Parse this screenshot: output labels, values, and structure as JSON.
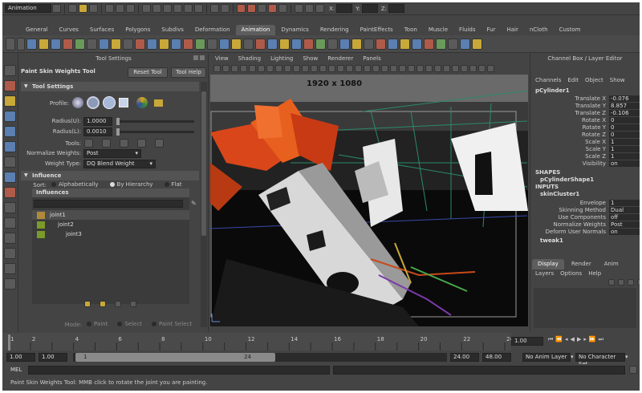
{
  "status_line": {
    "mode": "Animation",
    "x_label": "X:",
    "y_label": "Y:",
    "z_label": "Z:"
  },
  "shelf_tabs": [
    "General",
    "Curves",
    "Surfaces",
    "Polygons",
    "Subdivs",
    "Deformation",
    "Animation",
    "Dynamics",
    "Rendering",
    "PaintEffects",
    "Toon",
    "Muscle",
    "Fluids",
    "Fur",
    "Hair",
    "nCloth",
    "Custom"
  ],
  "shelf_active": "Animation",
  "tool_settings": {
    "panel_title": "Tool Settings",
    "tool_name": "Paint Skin Weights Tool",
    "reset_tool": "Reset Tool",
    "tool_help": "Tool Help",
    "section_title": "Tool Settings",
    "profile_label": "Profile:",
    "radius_u_label": "Radius(U):",
    "radius_u_value": "1.0000",
    "radius_l_label": "Radius(L):",
    "radius_l_value": "0.0010",
    "tools_label": "Tools:",
    "normalize_label": "Normalize Weights:",
    "normalize_value": "Post",
    "weight_type_label": "Weight Type:",
    "weight_type_value": "DQ Blend Weight",
    "influence_title": "Influence",
    "sort_label": "Sort:",
    "sort_options": [
      "Alphabetically",
      "By Hierarchy",
      "Flat"
    ],
    "sort_selected": "By Hierarchy",
    "influences_header": "Influences",
    "joints": [
      "joint1",
      "joint2",
      "joint3"
    ],
    "mode_label": "Mode:",
    "mode_options": [
      "Paint",
      "Select",
      "Paint Select"
    ]
  },
  "viewport": {
    "menu": [
      "View",
      "Shading",
      "Lighting",
      "Show",
      "Renderer",
      "Panels"
    ],
    "resolution": "1920 x 1080"
  },
  "channel_box": {
    "title": "Channel Box / Layer Editor",
    "menu": [
      "Channels",
      "Edit",
      "Object",
      "Show"
    ],
    "object": "pCylinder1",
    "channels": [
      {
        "name": "Translate X",
        "value": "-0.076"
      },
      {
        "name": "Translate Y",
        "value": "8.857"
      },
      {
        "name": "Translate Z",
        "value": "-0.106"
      },
      {
        "name": "Rotate X",
        "value": "0"
      },
      {
        "name": "Rotate Y",
        "value": "0"
      },
      {
        "name": "Rotate Z",
        "value": "0"
      },
      {
        "name": "Scale X",
        "value": "1"
      },
      {
        "name": "Scale Y",
        "value": "1"
      },
      {
        "name": "Scale Z",
        "value": "1"
      },
      {
        "name": "Visibility",
        "value": "on"
      }
    ],
    "shapes_label": "SHAPES",
    "shape_name": "pCylinderShape1",
    "inputs_label": "INPUTS",
    "input_name": "skinCluster1",
    "input_channels": [
      {
        "name": "Envelope",
        "value": "1"
      },
      {
        "name": "Skinning Method",
        "value": "Dual Qua..."
      },
      {
        "name": "Use Components",
        "value": "off"
      },
      {
        "name": "Normalize Weights",
        "value": "Post"
      },
      {
        "name": "Deform User Normals",
        "value": "on"
      }
    ],
    "tweak": "tweak1",
    "layer_tabs": [
      "Display",
      "Render",
      "Anim"
    ],
    "layer_menu": [
      "Layers",
      "Options",
      "Help"
    ]
  },
  "timeline": {
    "ticks": [
      "1",
      "2",
      "4",
      "6",
      "8",
      "10",
      "12",
      "14",
      "16",
      "18",
      "20",
      "22",
      "24"
    ],
    "current_frame": "1.00"
  },
  "range": {
    "start": "1.00",
    "playback_start": "1.00",
    "slider_start": "1",
    "slider_end": "24",
    "playback_end": "24.00",
    "end": "48.00",
    "anim_layer": "No Anim Layer",
    "character_set": "No Character Set"
  },
  "command_line": {
    "label": "MEL"
  },
  "help_line": {
    "text": "Paint Skin Weights Tool: MMB click to rotate the joint you are painting."
  },
  "colors": {
    "bg": "#444444",
    "dark": "#2b2b2b",
    "joint1": "#b08a3a",
    "joint2": "#7a9a2a",
    "joint3": "#7a9a2a"
  }
}
